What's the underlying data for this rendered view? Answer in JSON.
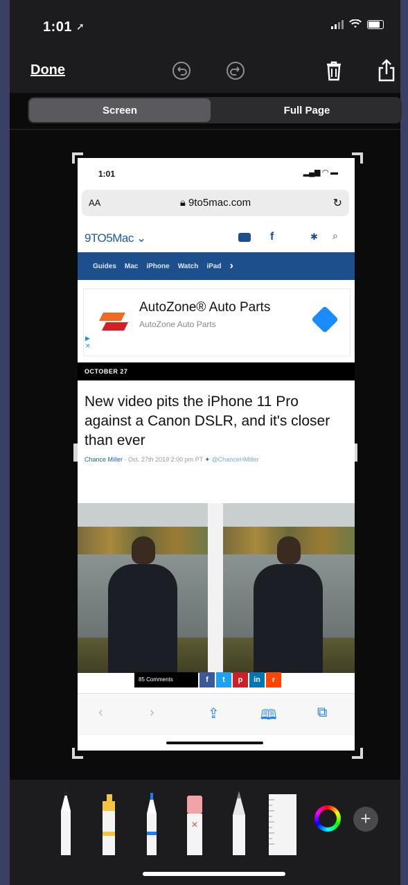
{
  "status_bar": {
    "time": "1:01"
  },
  "toolbar": {
    "done_label": "Done"
  },
  "segmented": {
    "screen": "Screen",
    "full_page": "Full Page"
  },
  "preview": {
    "status_time": "1:01",
    "address": {
      "aa": "AA",
      "url": "9to5mac.com"
    },
    "site_logo": "9TO5Mac",
    "nav_items": [
      "Guides",
      "Mac",
      "iPhone",
      "Watch",
      "iPad"
    ],
    "ad": {
      "title": "AutoZone® Auto Parts",
      "subtitle": "AutoZone Auto Parts",
      "logo_text": "AutoZone"
    },
    "date_label": "OCTOBER 27",
    "headline": "New video pits the iPhone 11 Pro against a Canon DSLR, and it's closer than ever",
    "byline": {
      "author": "Chance Miller",
      "meta": "- Oct. 27th 2019 2:00 pm PT",
      "twitter": "@ChanceHMiller"
    },
    "comments_label": "85 Comments"
  }
}
